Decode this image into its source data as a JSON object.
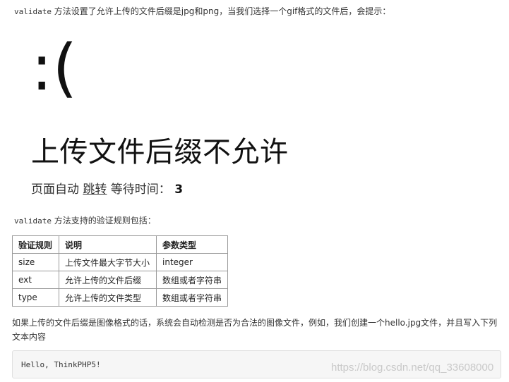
{
  "intro": {
    "code": "validate",
    "text": " 方法设置了允许上传的文件后缀是jpg和png，当我们选择一个gif格式的文件后，会提示："
  },
  "error_page": {
    "face": ":(",
    "title": "上传文件后缀不允许",
    "redirect_prefix": "页面自动 ",
    "redirect_link": "跳转",
    "redirect_suffix": " 等待时间： ",
    "wait_seconds": "3"
  },
  "rules_intro": {
    "code": "validate",
    "text": " 方法支持的验证规则包括："
  },
  "rules_table": {
    "headers": [
      "验证规则",
      "说明",
      "参数类型"
    ],
    "rows": [
      [
        "size",
        "上传文件最大字节大小",
        "integer"
      ],
      [
        "ext",
        "允许上传的文件后缀",
        "数组或者字符串"
      ],
      [
        "type",
        "允许上传的文件类型",
        "数组或者字符串"
      ]
    ]
  },
  "paragraph": "如果上传的文件后缀是图像格式的话，系统会自动检测是否为合法的图像文件，例如，我们创建一个hello.jpg文件，并且写入下列文本内容",
  "code_block": "Hello, ThinkPHP5!",
  "watermark": "https://blog.csdn.net/qq_33608000"
}
